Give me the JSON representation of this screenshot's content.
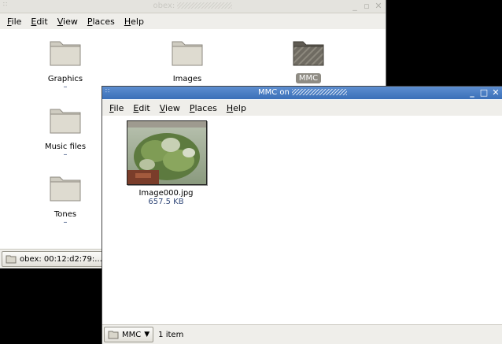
{
  "back_window": {
    "title_prefix": "obex:",
    "menu": [
      "File",
      "Edit",
      "View",
      "Places",
      "Help"
    ],
    "menu_mnemonics": [
      "F",
      "E",
      "V",
      "P",
      "H"
    ],
    "items": [
      {
        "label": "Graphics",
        "sub": "–"
      },
      {
        "label": "Images",
        "sub": ""
      },
      {
        "label": "MMC",
        "sub": "",
        "selected": true
      },
      {
        "label": "Music files",
        "sub": "–"
      },
      {
        "label": "Tones",
        "sub": "–"
      }
    ],
    "location": "obex: 00:12:d2:79:..."
  },
  "front_window": {
    "title_prefix": "MMC on",
    "menu": [
      "File",
      "Edit",
      "View",
      "Places",
      "Help"
    ],
    "file": {
      "name": "Image000.jpg",
      "size": "657.5 KB"
    },
    "location": "MMC",
    "status": "1 item"
  },
  "colors": {
    "titlebar_active": "#3a6fb8",
    "folder": "#d9d6cb",
    "selected_folder": "#6f6b62",
    "link_text": "#334a7a"
  }
}
